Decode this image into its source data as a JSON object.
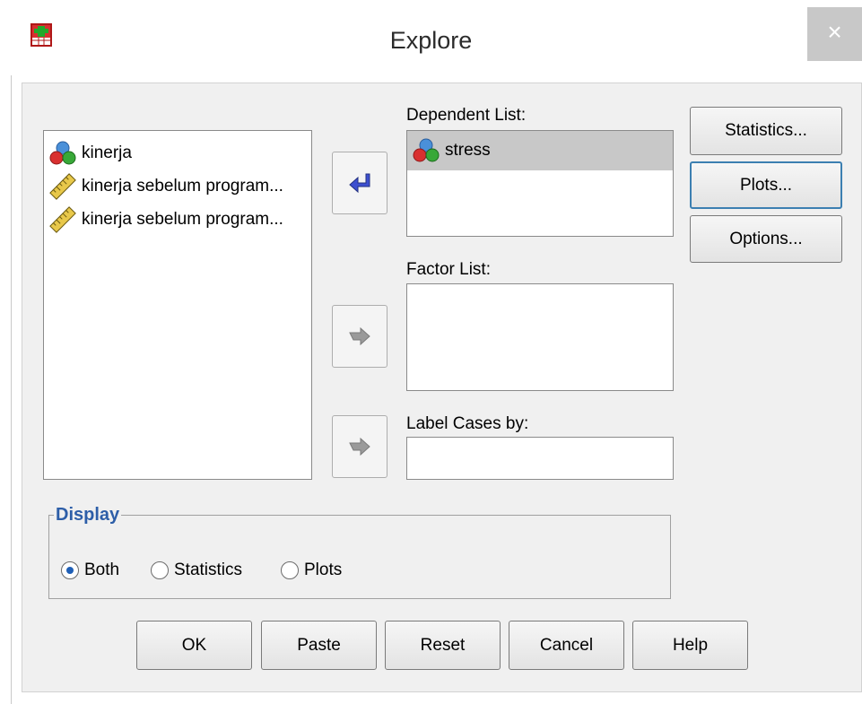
{
  "window": {
    "title": "Explore",
    "close_glyph": "×"
  },
  "source_list": {
    "items": [
      {
        "label": "kinerja",
        "icon": "nominal-variable-icon"
      },
      {
        "label": "kinerja sebelum program...",
        "icon": "scale-variable-icon"
      },
      {
        "label": "kinerja sebelum program...",
        "icon": "scale-variable-icon"
      }
    ]
  },
  "dependent_list": {
    "label": "Dependent List:",
    "items": [
      {
        "label": "stress",
        "icon": "nominal-variable-icon",
        "selected": true
      }
    ]
  },
  "factor_list": {
    "label": "Factor List:"
  },
  "label_cases": {
    "label": "Label Cases by:"
  },
  "side_buttons": {
    "statistics": "Statistics...",
    "plots": "Plots...",
    "options": "Options..."
  },
  "display": {
    "legend": "Display",
    "options": [
      {
        "label": "Both",
        "selected": true
      },
      {
        "label": "Statistics",
        "selected": false
      },
      {
        "label": "Plots",
        "selected": false
      }
    ]
  },
  "bottom_buttons": {
    "ok": "OK",
    "paste": "Paste",
    "reset": "Reset",
    "cancel": "Cancel",
    "help": "Help"
  },
  "colors": {
    "arrow_active": "#3d4fd0",
    "arrow_inactive": "#9a9a9a",
    "selection": "#c8c8c8",
    "legend": "#2d5ea8"
  }
}
